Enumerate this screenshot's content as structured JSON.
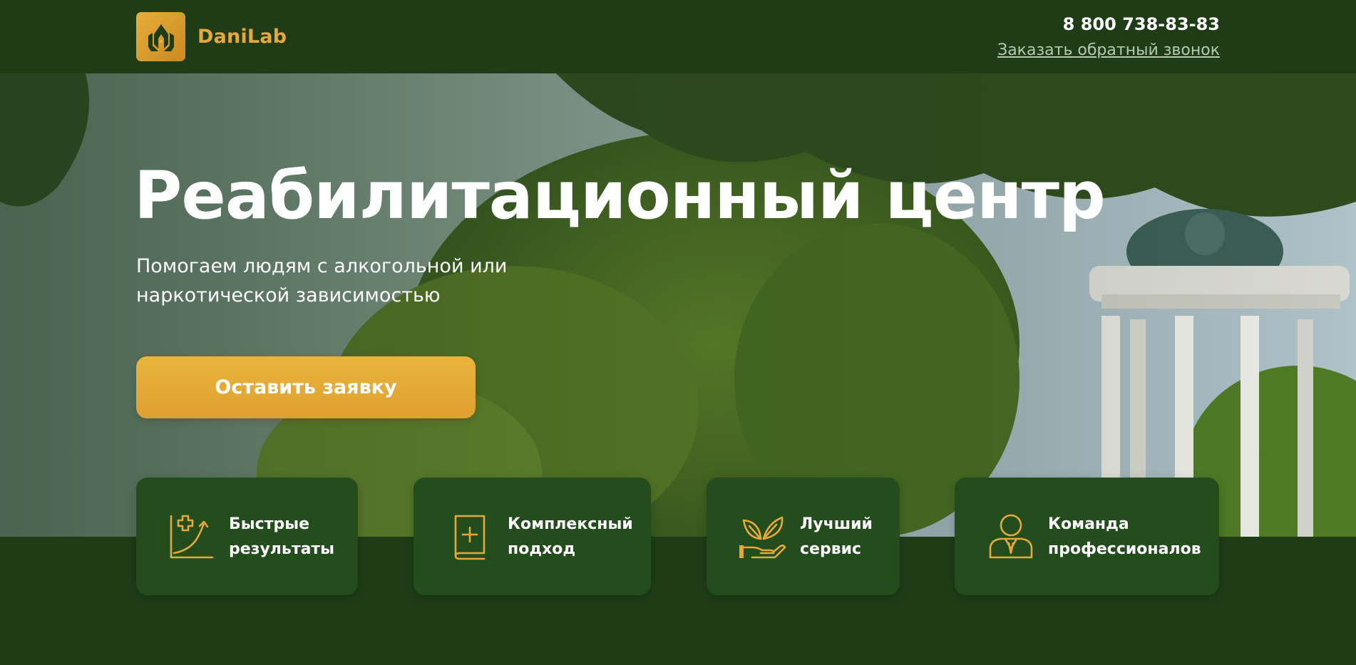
{
  "header": {
    "brand": "DaniLab",
    "phone": "8 800 738-83-83",
    "callback_label": "Заказать обратный звонок"
  },
  "hero": {
    "title": "Реабилитационный центр",
    "subtitle": "Помогаем людям с алкогольной или наркотической зависимостью",
    "cta_label": "Оставить заявку"
  },
  "features": [
    {
      "label": "Быстрые результаты",
      "icon": "growth-chart-icon"
    },
    {
      "label": "Комплексный подход",
      "icon": "medical-book-icon"
    },
    {
      "label": "Лучший сервис",
      "icon": "hand-leaves-icon"
    },
    {
      "label": "Команда профессионалов",
      "icon": "professional-person-icon"
    }
  ],
  "colors": {
    "background": "#1e3d17",
    "card": "#244d1d",
    "accent": "#e6a83a",
    "text": "#ffffff"
  }
}
